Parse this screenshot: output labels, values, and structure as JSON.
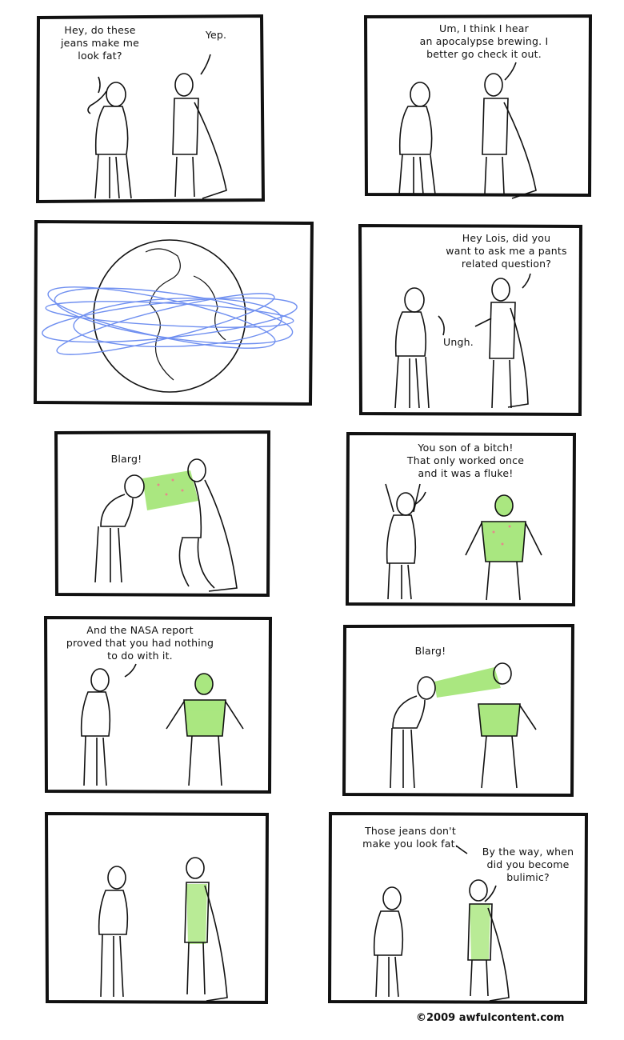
{
  "comic": {
    "panels": [
      {
        "lines": [
          "Hey, do these\njeans make me\nlook fat?",
          "Yep."
        ]
      },
      {
        "lines": [
          "Um, I think I hear\nan apocalypse brewing. I\nbetter go check it out."
        ]
      },
      {
        "lines": []
      },
      {
        "lines": [
          "Hey Lois, did you\nwant to ask me a pants\nrelated question?",
          "Ungh."
        ]
      },
      {
        "lines": [
          "Blarg!"
        ]
      },
      {
        "lines": [
          "You son of a bitch!\nThat only worked once\nand it was a fluke!"
        ]
      },
      {
        "lines": [
          "And the NASA report\nproved that you had nothing\nto do with it."
        ]
      },
      {
        "lines": [
          "Blarg!"
        ]
      },
      {
        "lines": []
      },
      {
        "lines": [
          "Those jeans don't\nmake you look fat.",
          "By the way, when\ndid you become\nbulimic?"
        ]
      }
    ],
    "copyright": "©2009 awfulcontent.com"
  },
  "colors": {
    "ink": "#111111",
    "vomit": "#9be36a",
    "vomit_spots": "#e58a8a",
    "orbit": "#6f8ff0"
  }
}
